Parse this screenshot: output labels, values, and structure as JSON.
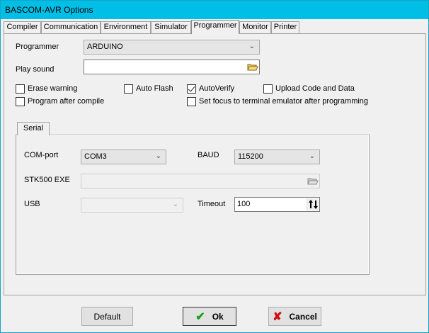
{
  "window": {
    "title": "BASCOM-AVR Options"
  },
  "tabs": [
    "Compiler",
    "Communication",
    "Environment",
    "Simulator",
    "Programmer",
    "Monitor",
    "Printer"
  ],
  "active_tab": "Programmer",
  "programmer": {
    "programmer_label": "Programmer",
    "programmer_value": "ARDUINO",
    "play_sound_label": "Play sound",
    "play_sound_value": "",
    "checkboxes": {
      "erase_warning": {
        "label": "Erase warning",
        "checked": false
      },
      "auto_flash": {
        "label": "Auto Flash",
        "checked": false
      },
      "auto_verify": {
        "label": "AutoVerify",
        "checked": true
      },
      "upload_code_data": {
        "label": "Upload Code and Data",
        "checked": false
      },
      "program_after_compile": {
        "label": "Program after compile",
        "checked": false
      },
      "set_focus_terminal": {
        "label": "Set focus to terminal emulator after programming",
        "checked": false
      }
    }
  },
  "serial": {
    "tab_label": "Serial",
    "comport_label": "COM-port",
    "comport_value": "COM3",
    "baud_label": "BAUD",
    "baud_value": "115200",
    "stk500_label": "STK500 EXE",
    "stk500_value": "",
    "usb_label": "USB",
    "usb_value": "",
    "timeout_label": "Timeout",
    "timeout_value": "100"
  },
  "buttons": {
    "default_label": "Default",
    "ok_label": "Ok",
    "cancel_label": "Cancel"
  },
  "colors": {
    "titlebar": "#00bfe6",
    "ok_check": "#1a9e1a",
    "cancel_x": "#cc1111"
  }
}
